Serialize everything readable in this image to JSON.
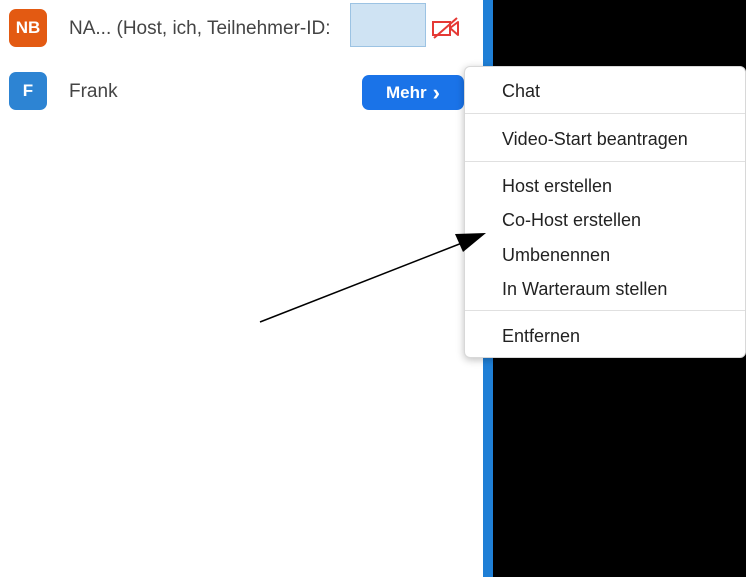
{
  "participants": [
    {
      "initials": "NB",
      "name": "NA... (Host, ich, Teilnehmer-ID:",
      "avatar_color": "#e35a12"
    },
    {
      "initials": "F",
      "name": "Frank",
      "avatar_color": "#2d84d3"
    }
  ],
  "more_button": {
    "label": "Mehr",
    "chevron": "›"
  },
  "context_menu": {
    "items": [
      "Chat",
      "Video-Start beantragen",
      "Host erstellen",
      "Co-Host erstellen",
      "Umbenennen",
      "In Warteraum stellen",
      "Entfernen"
    ]
  },
  "colors": {
    "accent": "#1a73e8",
    "divider": "#1f7fd6",
    "video_bg": "#000000",
    "muted_camera": "#e53935"
  },
  "icons": {
    "camera_off": "video-off-icon"
  }
}
